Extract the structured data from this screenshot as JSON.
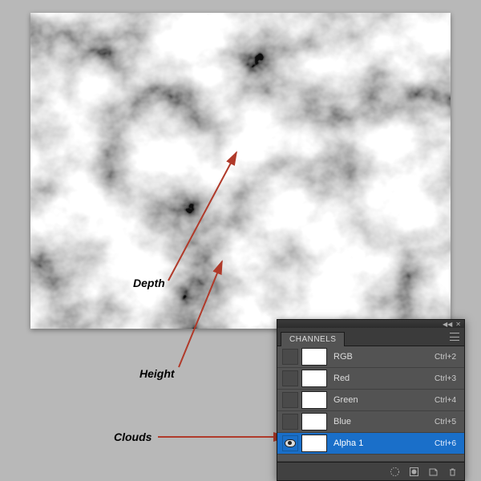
{
  "annotations": {
    "depth": "Depth",
    "height": "Height",
    "clouds": "Clouds"
  },
  "panel": {
    "tab": "CHANNELS",
    "channels": [
      {
        "name": "RGB",
        "shortcut": "Ctrl+2"
      },
      {
        "name": "Red",
        "shortcut": "Ctrl+3"
      },
      {
        "name": "Green",
        "shortcut": "Ctrl+4"
      },
      {
        "name": "Blue",
        "shortcut": "Ctrl+5"
      },
      {
        "name": "Alpha 1",
        "shortcut": "Ctrl+6"
      }
    ]
  }
}
